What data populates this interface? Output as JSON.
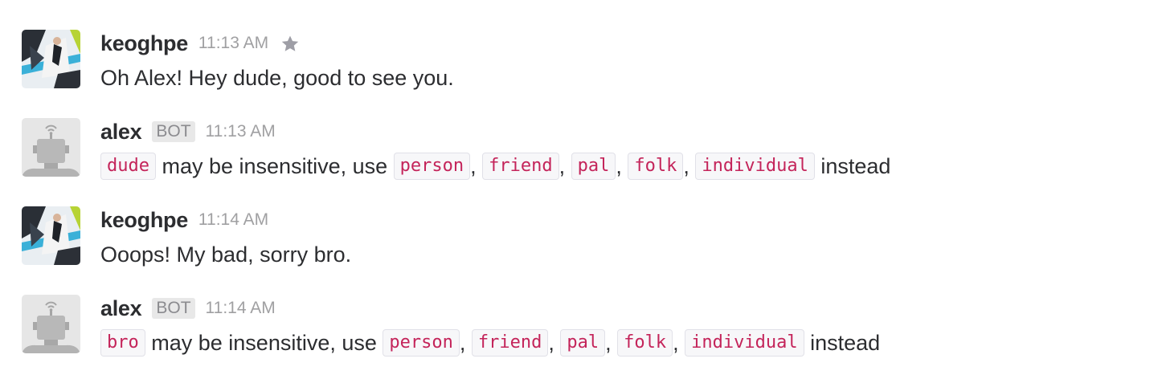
{
  "messages": [
    {
      "username": "keoghpe",
      "time": "11:13 AM",
      "text": "Oh Alex! Hey dude, good to see you."
    },
    {
      "username": "alex",
      "badge": "BOT",
      "time": "11:13 AM",
      "flagged": "dude",
      "mid_text": " may be insensitive, use ",
      "suggestions": [
        "person",
        "friend",
        "pal",
        "folk",
        "individual"
      ],
      "separator": ", ",
      "end_text": " instead"
    },
    {
      "username": "keoghpe",
      "time": "11:14 AM",
      "text": "Ooops! My bad, sorry bro."
    },
    {
      "username": "alex",
      "badge": "BOT",
      "time": "11:14 AM",
      "flagged": "bro",
      "mid_text": " may be insensitive, use ",
      "suggestions": [
        "person",
        "friend",
        "pal",
        "folk",
        "individual"
      ],
      "separator": ", ",
      "end_text": " instead"
    }
  ],
  "icons": {
    "star": "star-icon",
    "user_avatar": "user-avatar-photo",
    "bot_avatar": "robot-avatar"
  },
  "colors": {
    "code_text": "#c4245a",
    "code_bg": "#f7f7f9",
    "timestamp": "#a0a0a2",
    "star": "#9e9ea6"
  }
}
